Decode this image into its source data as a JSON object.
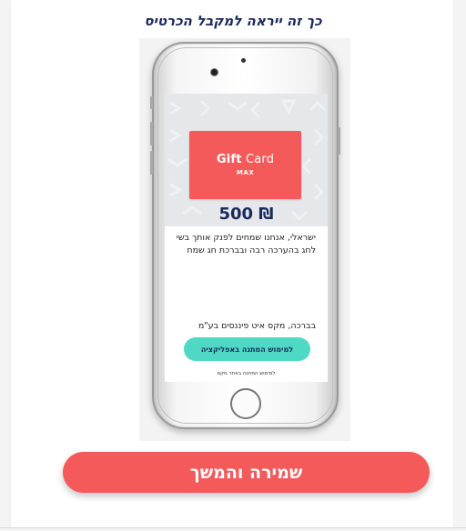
{
  "header": {
    "title": "כך זה ייראה למקבל הכרטיס"
  },
  "card": {
    "title_bold": "Gift",
    "title_light": " Card",
    "brand": "MAX",
    "amount": "500 ₪"
  },
  "message": {
    "body": "ישראלי, אנחנו שמחים לפנק אותך בשי לחג בהערכה רבה ובברכת חג שמח",
    "signature": "בברכה, מקס איט פיננסים בע\"מ"
  },
  "phone_screen": {
    "app_button_label": "למימוש המתנה באפליקציה",
    "website_link": "למימוש המתנה באתר מקס"
  },
  "actions": {
    "save_label": "שמירה והמשך"
  },
  "colors": {
    "accent_red": "#f55a5a",
    "teal": "#4fd9c4",
    "navy": "#1b2a5c"
  }
}
